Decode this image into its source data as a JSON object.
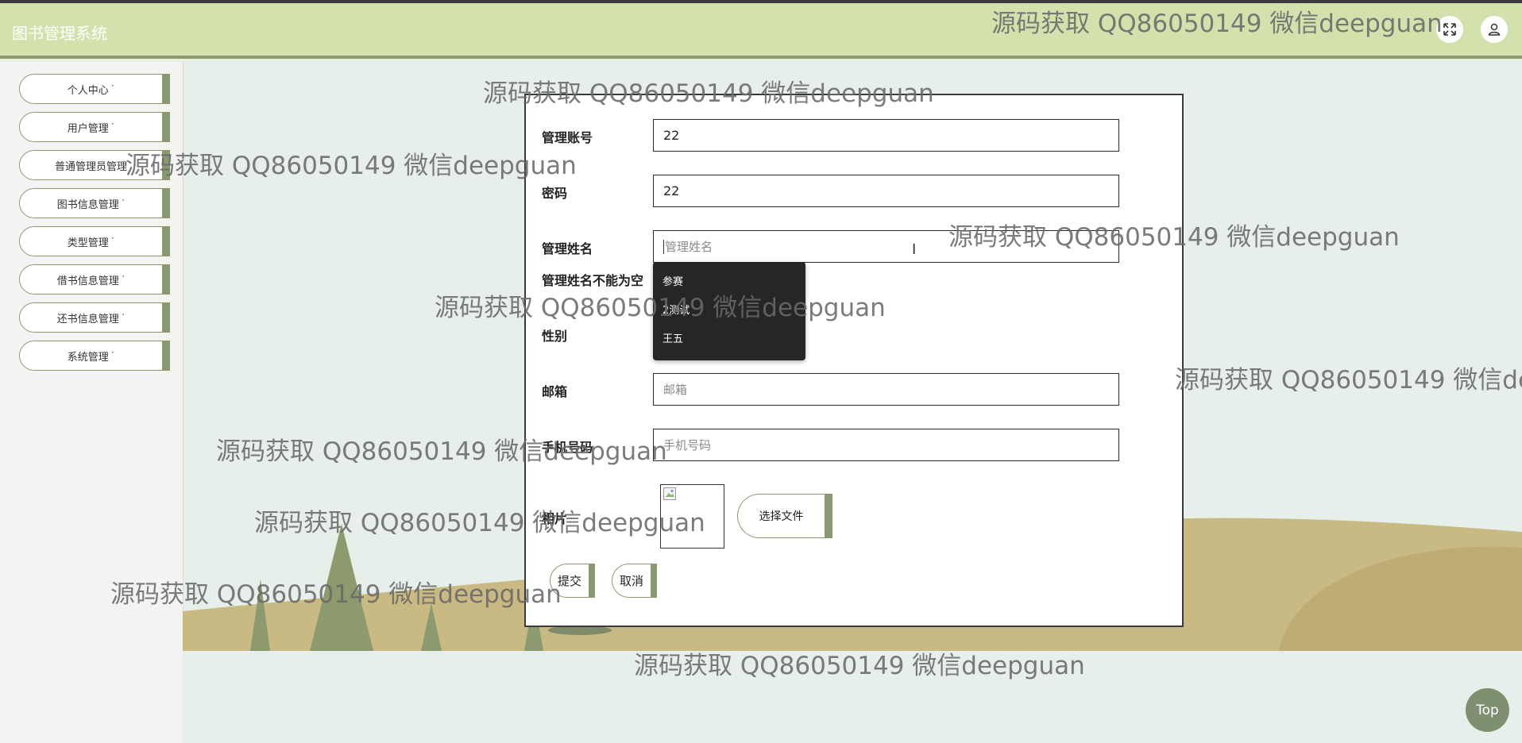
{
  "app": {
    "title": "图书管理系统"
  },
  "header": {
    "fullscreen_icon": "expand-icon",
    "user_icon": "user-icon"
  },
  "sidebar": {
    "items": [
      {
        "label": "个人中心"
      },
      {
        "label": "用户管理"
      },
      {
        "label": "普通管理员管理"
      },
      {
        "label": "图书信息管理"
      },
      {
        "label": "类型管理"
      },
      {
        "label": "借书信息管理"
      },
      {
        "label": "还书信息管理"
      },
      {
        "label": "系统管理"
      }
    ],
    "caret": "˅"
  },
  "form": {
    "account": {
      "label": "管理账号",
      "value": "22"
    },
    "password": {
      "label": "密码",
      "value": "22"
    },
    "name": {
      "label": "管理姓名",
      "placeholder": "管理姓名",
      "value": "",
      "error": "管理姓名不能为空"
    },
    "gender": {
      "label": "性别"
    },
    "email": {
      "label": "邮箱",
      "placeholder": "邮箱"
    },
    "phone": {
      "label": "手机号码",
      "placeholder": "手机号码"
    },
    "photo": {
      "label": "相片",
      "choose_file": "选择文件"
    },
    "submit": "提交",
    "cancel": "取消"
  },
  "autocomplete": {
    "options": [
      "参赛",
      "2测试",
      "王五"
    ]
  },
  "back_to_top": "Top",
  "watermark": "源码获取 QQ86050149 微信deepguan",
  "colors": {
    "header_bg": "#d3e2ad",
    "accent": "#8a9a70",
    "page_bg": "#e6efe9"
  }
}
